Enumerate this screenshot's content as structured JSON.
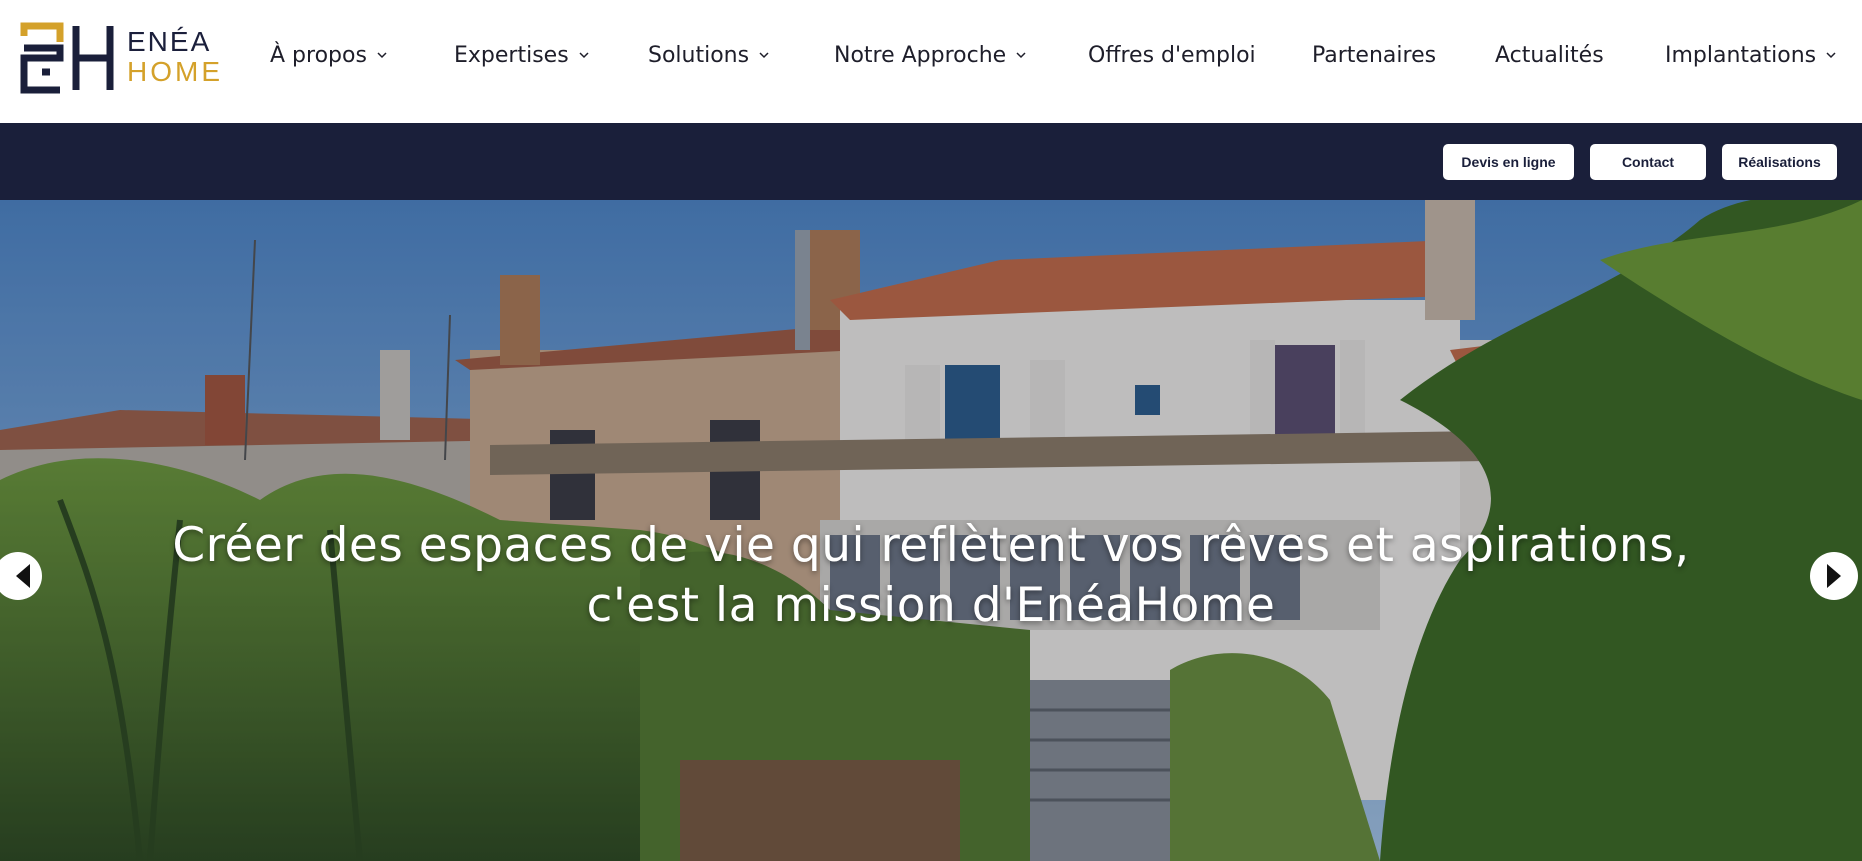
{
  "brand": {
    "name_line1": "ENÉA",
    "name_line2": "HOME",
    "colors": {
      "navy": "#1a1f3a",
      "gold": "#d4a12a"
    }
  },
  "nav": {
    "items": [
      {
        "label": "À propos",
        "has_dropdown": true
      },
      {
        "label": "Expertises",
        "has_dropdown": true
      },
      {
        "label": "Solutions",
        "has_dropdown": true
      },
      {
        "label": "Notre Approche",
        "has_dropdown": true
      },
      {
        "label": "Offres d'emploi",
        "has_dropdown": false
      },
      {
        "label": "Partenaires",
        "has_dropdown": false
      },
      {
        "label": "Actualités",
        "has_dropdown": false
      },
      {
        "label": "Implantations",
        "has_dropdown": true
      }
    ]
  },
  "topbar": {
    "buttons": [
      {
        "label": "Devis en ligne"
      },
      {
        "label": "Contact"
      },
      {
        "label": "Réalisations"
      }
    ]
  },
  "hero": {
    "tagline_line1": "Créer des espaces de vie qui reflètent vos rêves et aspirations,",
    "tagline_line2": "c'est la mission d'EnéaHome",
    "prev_icon": "chevron-left-icon",
    "next_icon": "chevron-right-icon"
  }
}
